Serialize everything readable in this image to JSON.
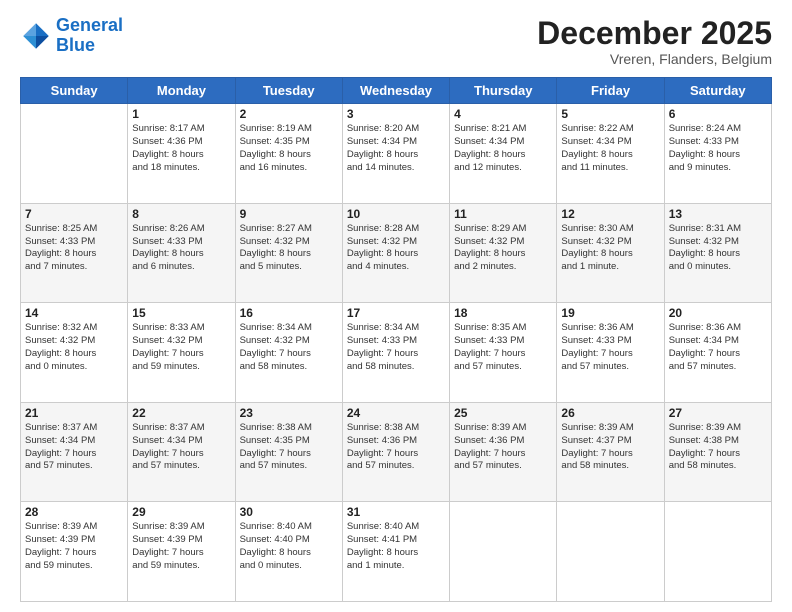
{
  "header": {
    "logo_line1": "General",
    "logo_line2": "Blue",
    "month": "December 2025",
    "location": "Vreren, Flanders, Belgium"
  },
  "weekdays": [
    "Sunday",
    "Monday",
    "Tuesday",
    "Wednesday",
    "Thursday",
    "Friday",
    "Saturday"
  ],
  "weeks": [
    [
      {
        "day": "",
        "info": ""
      },
      {
        "day": "1",
        "info": "Sunrise: 8:17 AM\nSunset: 4:36 PM\nDaylight: 8 hours\nand 18 minutes."
      },
      {
        "day": "2",
        "info": "Sunrise: 8:19 AM\nSunset: 4:35 PM\nDaylight: 8 hours\nand 16 minutes."
      },
      {
        "day": "3",
        "info": "Sunrise: 8:20 AM\nSunset: 4:34 PM\nDaylight: 8 hours\nand 14 minutes."
      },
      {
        "day": "4",
        "info": "Sunrise: 8:21 AM\nSunset: 4:34 PM\nDaylight: 8 hours\nand 12 minutes."
      },
      {
        "day": "5",
        "info": "Sunrise: 8:22 AM\nSunset: 4:34 PM\nDaylight: 8 hours\nand 11 minutes."
      },
      {
        "day": "6",
        "info": "Sunrise: 8:24 AM\nSunset: 4:33 PM\nDaylight: 8 hours\nand 9 minutes."
      }
    ],
    [
      {
        "day": "7",
        "info": "Sunrise: 8:25 AM\nSunset: 4:33 PM\nDaylight: 8 hours\nand 7 minutes."
      },
      {
        "day": "8",
        "info": "Sunrise: 8:26 AM\nSunset: 4:33 PM\nDaylight: 8 hours\nand 6 minutes."
      },
      {
        "day": "9",
        "info": "Sunrise: 8:27 AM\nSunset: 4:32 PM\nDaylight: 8 hours\nand 5 minutes."
      },
      {
        "day": "10",
        "info": "Sunrise: 8:28 AM\nSunset: 4:32 PM\nDaylight: 8 hours\nand 4 minutes."
      },
      {
        "day": "11",
        "info": "Sunrise: 8:29 AM\nSunset: 4:32 PM\nDaylight: 8 hours\nand 2 minutes."
      },
      {
        "day": "12",
        "info": "Sunrise: 8:30 AM\nSunset: 4:32 PM\nDaylight: 8 hours\nand 1 minute."
      },
      {
        "day": "13",
        "info": "Sunrise: 8:31 AM\nSunset: 4:32 PM\nDaylight: 8 hours\nand 0 minutes."
      }
    ],
    [
      {
        "day": "14",
        "info": "Sunrise: 8:32 AM\nSunset: 4:32 PM\nDaylight: 8 hours\nand 0 minutes."
      },
      {
        "day": "15",
        "info": "Sunrise: 8:33 AM\nSunset: 4:32 PM\nDaylight: 7 hours\nand 59 minutes."
      },
      {
        "day": "16",
        "info": "Sunrise: 8:34 AM\nSunset: 4:32 PM\nDaylight: 7 hours\nand 58 minutes."
      },
      {
        "day": "17",
        "info": "Sunrise: 8:34 AM\nSunset: 4:33 PM\nDaylight: 7 hours\nand 58 minutes."
      },
      {
        "day": "18",
        "info": "Sunrise: 8:35 AM\nSunset: 4:33 PM\nDaylight: 7 hours\nand 57 minutes."
      },
      {
        "day": "19",
        "info": "Sunrise: 8:36 AM\nSunset: 4:33 PM\nDaylight: 7 hours\nand 57 minutes."
      },
      {
        "day": "20",
        "info": "Sunrise: 8:36 AM\nSunset: 4:34 PM\nDaylight: 7 hours\nand 57 minutes."
      }
    ],
    [
      {
        "day": "21",
        "info": "Sunrise: 8:37 AM\nSunset: 4:34 PM\nDaylight: 7 hours\nand 57 minutes."
      },
      {
        "day": "22",
        "info": "Sunrise: 8:37 AM\nSunset: 4:34 PM\nDaylight: 7 hours\nand 57 minutes."
      },
      {
        "day": "23",
        "info": "Sunrise: 8:38 AM\nSunset: 4:35 PM\nDaylight: 7 hours\nand 57 minutes."
      },
      {
        "day": "24",
        "info": "Sunrise: 8:38 AM\nSunset: 4:36 PM\nDaylight: 7 hours\nand 57 minutes."
      },
      {
        "day": "25",
        "info": "Sunrise: 8:39 AM\nSunset: 4:36 PM\nDaylight: 7 hours\nand 57 minutes."
      },
      {
        "day": "26",
        "info": "Sunrise: 8:39 AM\nSunset: 4:37 PM\nDaylight: 7 hours\nand 58 minutes."
      },
      {
        "day": "27",
        "info": "Sunrise: 8:39 AM\nSunset: 4:38 PM\nDaylight: 7 hours\nand 58 minutes."
      }
    ],
    [
      {
        "day": "28",
        "info": "Sunrise: 8:39 AM\nSunset: 4:39 PM\nDaylight: 7 hours\nand 59 minutes."
      },
      {
        "day": "29",
        "info": "Sunrise: 8:39 AM\nSunset: 4:39 PM\nDaylight: 7 hours\nand 59 minutes."
      },
      {
        "day": "30",
        "info": "Sunrise: 8:40 AM\nSunset: 4:40 PM\nDaylight: 8 hours\nand 0 minutes."
      },
      {
        "day": "31",
        "info": "Sunrise: 8:40 AM\nSunset: 4:41 PM\nDaylight: 8 hours\nand 1 minute."
      },
      {
        "day": "",
        "info": ""
      },
      {
        "day": "",
        "info": ""
      },
      {
        "day": "",
        "info": ""
      }
    ]
  ]
}
